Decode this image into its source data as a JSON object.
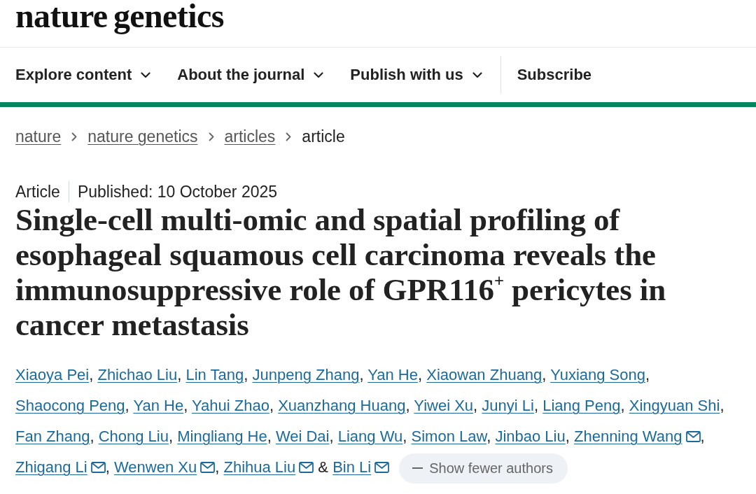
{
  "header": {
    "logo": "nature genetics"
  },
  "nav": {
    "items": [
      {
        "label": "Explore content",
        "kind": "menu"
      },
      {
        "label": "About the journal",
        "kind": "menu"
      },
      {
        "label": "Publish with us",
        "kind": "menu"
      },
      {
        "label": "Subscribe",
        "kind": "link"
      }
    ]
  },
  "breadcrumbs": [
    {
      "label": "nature",
      "kind": "link"
    },
    {
      "label": "nature genetics",
      "kind": "link"
    },
    {
      "label": "articles",
      "kind": "link"
    },
    {
      "label": "article",
      "kind": "current"
    }
  ],
  "article": {
    "type": "Article",
    "published": "Published: 10 October 2025",
    "title": "Single-cell multi-omic and spatial profiling of esophageal squamous cell carcinoma reveals the immunosuppressive role of GPR116$^{+}$ pericytes in cancer metastasis",
    "authors": [
      {
        "name": "Xiaoya Pei",
        "corresponding": false,
        "separator": ","
      },
      {
        "name": "Zhichao Liu",
        "corresponding": false,
        "separator": ","
      },
      {
        "name": "Lin Tang",
        "corresponding": false,
        "separator": ","
      },
      {
        "name": "Junpeng Zhang",
        "corresponding": false,
        "separator": ","
      },
      {
        "name": "Yan He",
        "corresponding": false,
        "separator": ","
      },
      {
        "name": "Xiaowan Zhuang",
        "corresponding": false,
        "separator": ","
      },
      {
        "name": "Yuxiang Song",
        "corresponding": false,
        "separator": ","
      },
      {
        "name": "Shaocong Peng",
        "corresponding": false,
        "separator": ","
      },
      {
        "name": "Yan He",
        "corresponding": false,
        "separator": ","
      },
      {
        "name": "Yahui Zhao",
        "corresponding": false,
        "separator": ","
      },
      {
        "name": "Xuanzhang Huang",
        "corresponding": false,
        "separator": ","
      },
      {
        "name": "Yiwei Xu",
        "corresponding": false,
        "separator": ","
      },
      {
        "name": "Junyi Li",
        "corresponding": false,
        "separator": ","
      },
      {
        "name": "Liang Peng",
        "corresponding": false,
        "separator": ","
      },
      {
        "name": "Xingyuan Shi",
        "corresponding": false,
        "separator": ","
      },
      {
        "name": "Fan Zhang",
        "corresponding": false,
        "separator": ","
      },
      {
        "name": "Chong Liu",
        "corresponding": false,
        "separator": ","
      },
      {
        "name": "Mingliang He",
        "corresponding": false,
        "separator": ","
      },
      {
        "name": "Wei Dai",
        "corresponding": false,
        "separator": ","
      },
      {
        "name": "Liang Wu",
        "corresponding": false,
        "separator": ","
      },
      {
        "name": "Simon Law",
        "corresponding": false,
        "separator": ","
      },
      {
        "name": "Jinbao Liu",
        "corresponding": false,
        "separator": ","
      },
      {
        "name": "Zhenning Wang",
        "corresponding": true,
        "separator": ","
      },
      {
        "name": "Zhigang Li",
        "corresponding": true,
        "separator": ","
      },
      {
        "name": "Wenwen Xu",
        "corresponding": true,
        "separator": ","
      },
      {
        "name": "Zhihua Liu",
        "corresponding": true,
        "separator": "&"
      },
      {
        "name": "Bin Li",
        "corresponding": true
      }
    ],
    "authors_toggle": {
      "label": "Show fewer authors"
    }
  }
}
